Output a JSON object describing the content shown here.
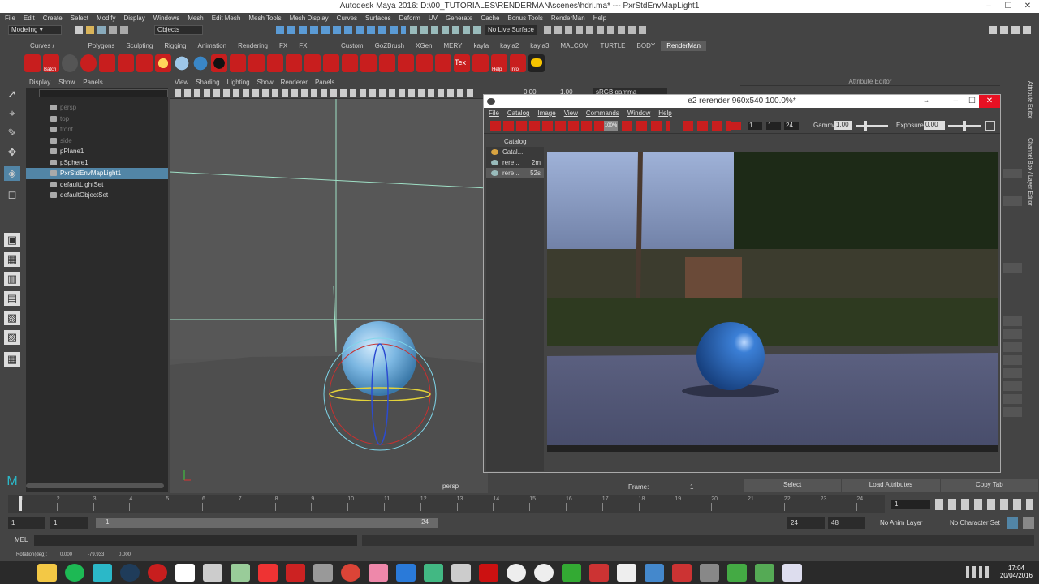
{
  "window": {
    "title": "Autodesk Maya 2016: D:\\00_TUTORIALES\\RENDERMAN\\scenes\\hdri.ma*    ---    PxrStdEnvMapLight1"
  },
  "menubar": [
    "File",
    "Edit",
    "Create",
    "Select",
    "Modify",
    "Display",
    "Windows",
    "Mesh",
    "Edit Mesh",
    "Mesh Tools",
    "Mesh Display",
    "Curves",
    "Surfaces",
    "Deform",
    "UV",
    "Generate",
    "Cache",
    "Bonus Tools",
    "RenderMan",
    "Help"
  ],
  "statusline": {
    "mode": "Modeling",
    "objects": "Objects",
    "live_surface": "No Live Surface"
  },
  "shelf_tabs": [
    "Curves / Surfaces",
    "Polygons",
    "Sculpting",
    "Rigging",
    "Animation",
    "Rendering",
    "FX",
    "FX Caching",
    "Custom",
    "GoZBrush",
    "XGen",
    "MERY",
    "kayla",
    "kayla2",
    "kayla3",
    "MALCOM",
    "TURTLE",
    "BODY",
    "RenderMan"
  ],
  "shelf_active": "RenderMan",
  "shelf_labels": {
    "batch": "Batch",
    "tex": "Tex",
    "help": "Help",
    "info": "Info"
  },
  "outliner": {
    "menu": [
      "Display",
      "Show",
      "Panels"
    ],
    "items": [
      {
        "label": "persp",
        "dim": true
      },
      {
        "label": "top",
        "dim": true
      },
      {
        "label": "front",
        "dim": true
      },
      {
        "label": "side",
        "dim": true
      },
      {
        "label": "pPlane1",
        "dim": false
      },
      {
        "label": "pSphere1",
        "dim": false
      },
      {
        "label": "PxrStdEnvMapLight1",
        "dim": false,
        "selected": true
      },
      {
        "label": "defaultLightSet",
        "dim": false
      },
      {
        "label": "defaultObjectSet",
        "dim": false
      }
    ]
  },
  "viewport": {
    "menu": [
      "View",
      "Shading",
      "Lighting",
      "Show",
      "Renderer",
      "Panels"
    ],
    "camera": "persp",
    "frame_label": "Frame:",
    "frame_value": "1",
    "field1": "0.00",
    "field2": "1.00",
    "colorspace": "sRGB gamma"
  },
  "attribute_editor": {
    "title": "Attribute Editor"
  },
  "render_window": {
    "title": "e2 rerender 960x540 100.0%*",
    "menu": [
      "File",
      "Catalog",
      "Image",
      "View",
      "Commands",
      "Window",
      "Help"
    ],
    "zoom": "100%",
    "frame_start": "1",
    "frame_cur": "1",
    "frame_end": "24",
    "gamma_label": "Gamma",
    "gamma_value": "1.00",
    "exposure_label": "Exposure",
    "exposure_value": "0.00",
    "catalog_title": "Catalog",
    "catalog_items": [
      {
        "label": "Catal...",
        "time": ""
      },
      {
        "label": "rere...",
        "time": "2m"
      },
      {
        "label": "rere...",
        "time": "52s"
      }
    ]
  },
  "right_tabs": [
    "Attribute Editor",
    "Channel Box / Layer Editor"
  ],
  "bottom_buttons": [
    "Select",
    "Load Attributes",
    "Copy Tab"
  ],
  "timeline": {
    "ticks": [
      "1",
      "2",
      "3",
      "4",
      "5",
      "6",
      "7",
      "8",
      "9",
      "10",
      "11",
      "12",
      "13",
      "14",
      "15",
      "16",
      "17",
      "18",
      "19",
      "20",
      "21",
      "22",
      "23",
      "24"
    ],
    "current_frame": "1"
  },
  "range": {
    "start": "1",
    "inner_start": "1",
    "slider_start": "1",
    "slider_end": "24",
    "end": "24",
    "total_end": "48",
    "anim_layer": "No Anim Layer",
    "char_set": "No Character Set"
  },
  "mel": {
    "label": "MEL"
  },
  "helpline": {
    "text": "Rotation(deg):",
    "x": "0.000",
    "y": "-79.933",
    "z": "0.000"
  },
  "taskbar": {
    "time": "17:04",
    "date": "20/04/2016"
  },
  "colors": {
    "accent": "#5285a6",
    "renderman_red": "#c81e1e",
    "sphere_blue": "#3a87c7"
  }
}
